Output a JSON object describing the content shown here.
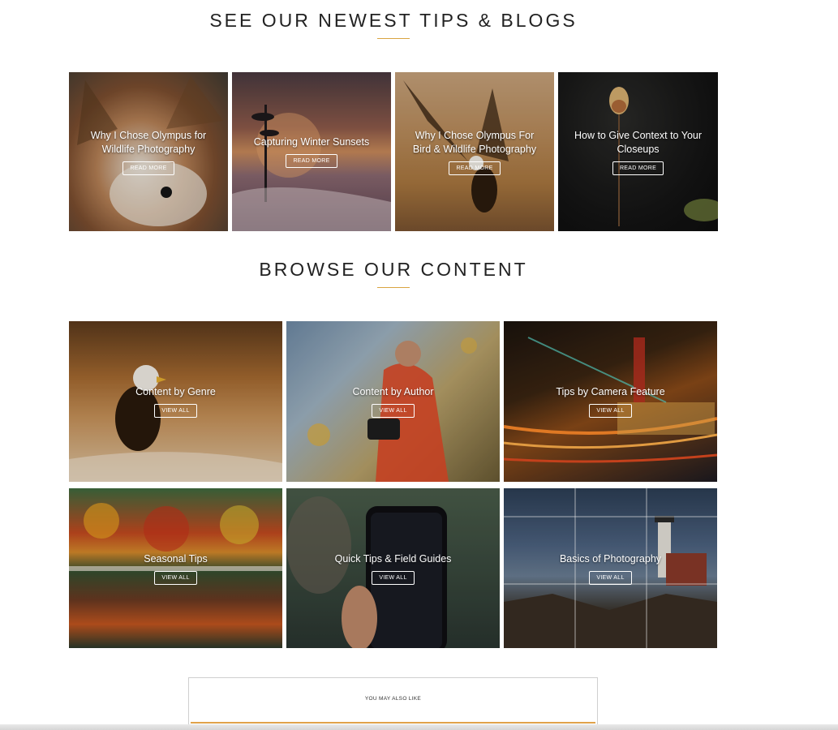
{
  "newest": {
    "title": "SEE OUR NEWEST TIPS & BLOGS",
    "button_label": "READ MORE",
    "posts": [
      {
        "title": "Why I Chose Olympus for Wildlife Photography"
      },
      {
        "title": "Capturing Winter Sunsets"
      },
      {
        "title": "Why I Chose Olympus For Bird & Wildlife Photography"
      },
      {
        "title": "How to Give Context to Your Closeups"
      }
    ]
  },
  "browse": {
    "title": "BROWSE OUR CONTENT",
    "button_label": "VIEW ALL",
    "categories": [
      {
        "title": "Content by Genre"
      },
      {
        "title": "Content by Author"
      },
      {
        "title": "Tips by Camera Feature"
      },
      {
        "title": "Seasonal Tips"
      },
      {
        "title": "Quick Tips & Field Guides"
      },
      {
        "title": "Basics of Photography"
      }
    ]
  },
  "also_like": {
    "label": "YOU MAY ALSO LIKE"
  },
  "colors": {
    "accent": "#d9a441"
  }
}
